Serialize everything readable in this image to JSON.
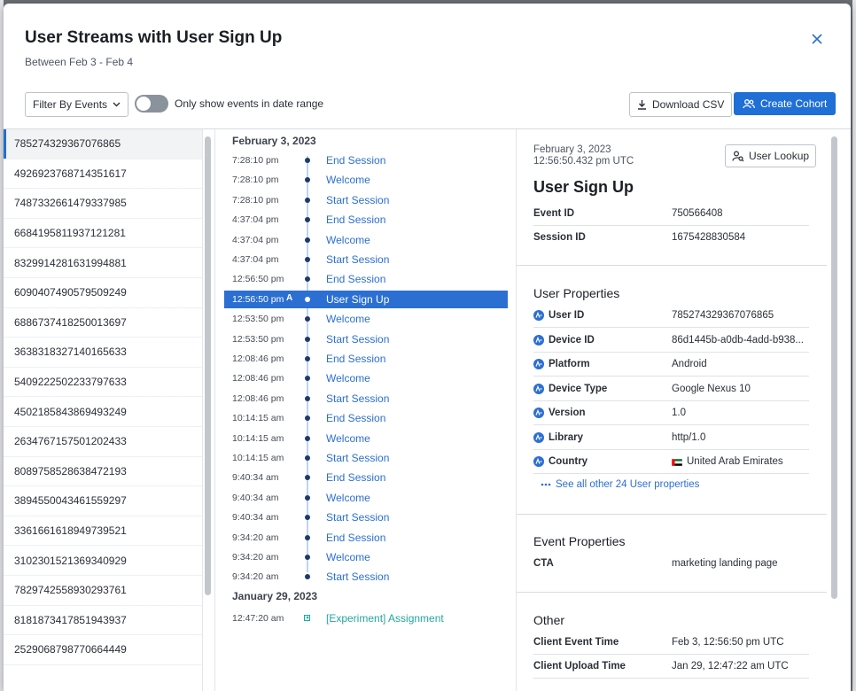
{
  "header": {
    "title": "User Streams with User Sign Up",
    "subtitle": "Between Feb 3 - Feb 4"
  },
  "toolbar": {
    "filter_label": "Filter By Events",
    "toggle_label": "Only show events in date range",
    "toggle_on": false,
    "download_label": "Download CSV",
    "cohort_label": "Create Cohort"
  },
  "users": [
    "785274329367076865",
    "4926923768714351617",
    "7487332661479337985",
    "6684195811937121281",
    "8329914281631994881",
    "6090407490579509249",
    "6886737418250013697",
    "3638318327140165633",
    "5409222502233797633",
    "4502185843869493249",
    "2634767157501202433",
    "8089758528638472193",
    "3894550043461559297",
    "3361661618949739521",
    "3102301521369340929",
    "7829742558930293761",
    "8181873417851943937",
    "2529068798770664449"
  ],
  "events": {
    "groups": [
      {
        "date": "February 3, 2023",
        "items": [
          {
            "time": "7:28:10 pm",
            "name": "End Session"
          },
          {
            "time": "7:28:10 pm",
            "name": "Welcome"
          },
          {
            "time": "7:28:10 pm",
            "name": "Start Session"
          },
          {
            "time": "4:37:04 pm",
            "name": "End Session"
          },
          {
            "time": "4:37:04 pm",
            "name": "Welcome"
          },
          {
            "time": "4:37:04 pm",
            "name": "Start Session"
          },
          {
            "time": "12:56:50 pm",
            "name": "End Session"
          },
          {
            "time": "12:56:50 pm",
            "name": "User Sign Up",
            "badge": "A"
          },
          {
            "time": "12:53:50 pm",
            "name": "Welcome"
          },
          {
            "time": "12:53:50 pm",
            "name": "Start Session"
          },
          {
            "time": "12:08:46 pm",
            "name": "End Session"
          },
          {
            "time": "12:08:46 pm",
            "name": "Welcome"
          },
          {
            "time": "12:08:46 pm",
            "name": "Start Session"
          },
          {
            "time": "10:14:15 am",
            "name": "End Session"
          },
          {
            "time": "10:14:15 am",
            "name": "Welcome"
          },
          {
            "time": "10:14:15 am",
            "name": "Start Session"
          },
          {
            "time": "9:40:34 am",
            "name": "End Session"
          },
          {
            "time": "9:40:34 am",
            "name": "Welcome"
          },
          {
            "time": "9:40:34 am",
            "name": "Start Session"
          },
          {
            "time": "9:34:20 am",
            "name": "End Session"
          },
          {
            "time": "9:34:20 am",
            "name": "Welcome"
          },
          {
            "time": "9:34:20 am",
            "name": "Start Session"
          }
        ]
      },
      {
        "date": "January 29, 2023",
        "items": [
          {
            "time": "12:47:20 am",
            "name": "[Experiment] Assignment"
          }
        ]
      }
    ]
  },
  "detail": {
    "date": "February 3, 2023",
    "time": "12:56:50.432 pm UTC",
    "lookup_label": "User Lookup",
    "event_title": "User Sign Up",
    "event_fields": [
      {
        "key": "Event ID",
        "value": "750566408"
      },
      {
        "key": "Session ID",
        "value": "1675428830584"
      }
    ],
    "user_props_title": "User Properties",
    "user_props": [
      {
        "key": "User ID",
        "value": "785274329367076865"
      },
      {
        "key": "Device ID",
        "value": "86d1445b-a0db-4add-b938..."
      },
      {
        "key": "Platform",
        "value": "Android"
      },
      {
        "key": "Device Type",
        "value": "Google Nexus 10"
      },
      {
        "key": "Version",
        "value": "1.0"
      },
      {
        "key": "Library",
        "value": "http/1.0"
      },
      {
        "key": "Country",
        "value": "United Arab Emirates",
        "icon": "uae-flag-icon"
      }
    ],
    "see_all": "See all other 24 User properties",
    "event_props_title": "Event Properties",
    "event_props": [
      {
        "key": "CTA",
        "value": "marketing landing page"
      }
    ],
    "other_title": "Other",
    "other": [
      {
        "key": "Client Event Time",
        "value": "Feb 3, 12:56:50 pm UTC"
      },
      {
        "key": "Client Upload Time",
        "value": "Jan 29, 12:47:22 am UTC"
      }
    ]
  },
  "colors": {
    "accent": "#1f6fd6",
    "link": "#2b6fd2",
    "teal": "#23a79d",
    "timeline_dot": "#1e3a67"
  }
}
